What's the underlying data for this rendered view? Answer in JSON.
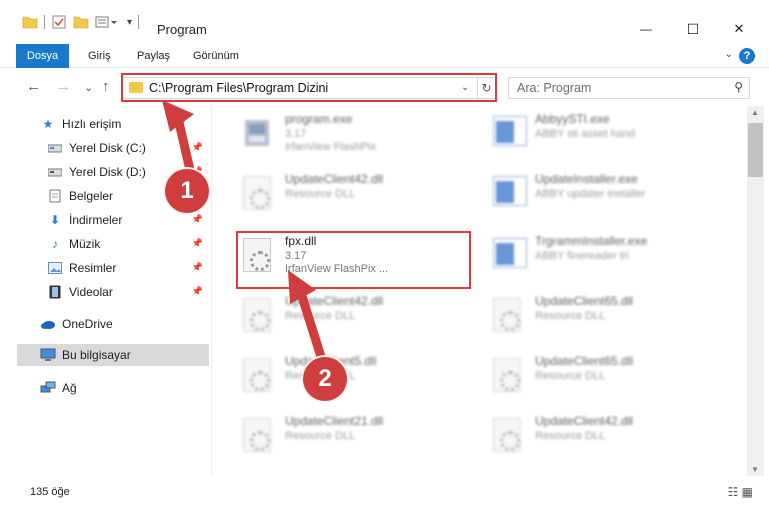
{
  "window": {
    "title": "Program",
    "minimize_glyph": "—",
    "maximize_glyph": "☐",
    "close_glyph": "✕"
  },
  "ribbon": {
    "tabs": [
      "Dosya",
      "Giriş",
      "Paylaş",
      "Görünüm"
    ],
    "help_glyph": "?",
    "expand_glyph": "⌄"
  },
  "nav": {
    "back_glyph": "←",
    "forward_glyph": "→",
    "recent_glyph": "⌄",
    "up_glyph": "↑",
    "address_path": "C:\\Program Files\\Program Dizini",
    "address_dropdown_glyph": "⌄",
    "refresh_glyph": "↻",
    "search_placeholder": "Ara: Program",
    "search_glyph": "⚲"
  },
  "sidebar": {
    "items": [
      {
        "label": "Hızlı erişim",
        "icon": "star-icon",
        "pinned": false
      },
      {
        "label": "Yerel Disk (C:)",
        "icon": "drive-icon",
        "pinned": true
      },
      {
        "label": "Yerel Disk (D:)",
        "icon": "drive-icon",
        "pinned": true
      },
      {
        "label": "Belgeler",
        "icon": "documents-icon",
        "pinned": true
      },
      {
        "label": "İndirmeler",
        "icon": "download-icon",
        "pinned": true
      },
      {
        "label": "Müzik",
        "icon": "music-icon",
        "pinned": true
      },
      {
        "label": "Resimler",
        "icon": "pictures-icon",
        "pinned": true
      },
      {
        "label": "Videolar",
        "icon": "videos-icon",
        "pinned": true
      },
      {
        "label": "OneDrive",
        "icon": "cloud-icon",
        "pinned": false
      },
      {
        "label": "Bu bilgisayar",
        "icon": "computer-icon",
        "pinned": false,
        "selected": true
      },
      {
        "label": "Ağ",
        "icon": "network-icon",
        "pinned": false
      }
    ],
    "pin_glyph": "📌"
  },
  "files": [
    {
      "name": "program.exe",
      "meta1": "3.17",
      "meta2": "IrfanView FlashPix",
      "icon": "app-icon",
      "blurred": true
    },
    {
      "name": "AbbyySTI.exe",
      "meta1": "ABBY sti asset hand",
      "meta2": "",
      "icon": "exe-icon",
      "blurred": true
    },
    {
      "name": "UpdateClient42.dll",
      "meta1": "Resource DLL",
      "meta2": "",
      "icon": "dll-icon",
      "blurred": true
    },
    {
      "name": "UpdateInstaller.exe",
      "meta1": "ABBY updater installer",
      "meta2": "",
      "icon": "exe-icon",
      "blurred": true
    },
    {
      "name": "fpx.dll",
      "meta1": "3.17",
      "meta2": "IrfanView FlashPix ...",
      "icon": "dll-icon",
      "blurred": false
    },
    {
      "name": "TrgrammInstaller.exe",
      "meta1": "ABBY finereader tri",
      "meta2": "",
      "icon": "exe-icon",
      "blurred": true
    },
    {
      "name": "UpdateClient42.dll",
      "meta1": "Resource DLL",
      "meta2": "",
      "icon": "dll-icon",
      "blurred": true
    },
    {
      "name": "UpdateClient65.dll",
      "meta1": "Resource DLL",
      "meta2": "",
      "icon": "dll-icon",
      "blurred": true
    },
    {
      "name": "UpdateClient5.dll",
      "meta1": "Resource DLL",
      "meta2": "",
      "icon": "dll-icon",
      "blurred": true
    },
    {
      "name": "UpdateClient65.dll",
      "meta1": "Resource DLL",
      "meta2": "",
      "icon": "dll-icon",
      "blurred": true
    },
    {
      "name": "UpdateClient21.dll",
      "meta1": "Resource DLL",
      "meta2": "",
      "icon": "dll-icon",
      "blurred": true
    },
    {
      "name": "UpdateClient42.dll",
      "meta1": "Resource DLL",
      "meta2": "",
      "icon": "dll-icon",
      "blurred": true
    }
  ],
  "status": {
    "item_count": "135 öğe",
    "views_glyph": "☷ ▦"
  },
  "annotations": {
    "badge1": "1",
    "badge2": "2",
    "accent_color": "#cf3d3d"
  },
  "scroll": {
    "up_glyph": "▲",
    "down_glyph": "▼"
  }
}
